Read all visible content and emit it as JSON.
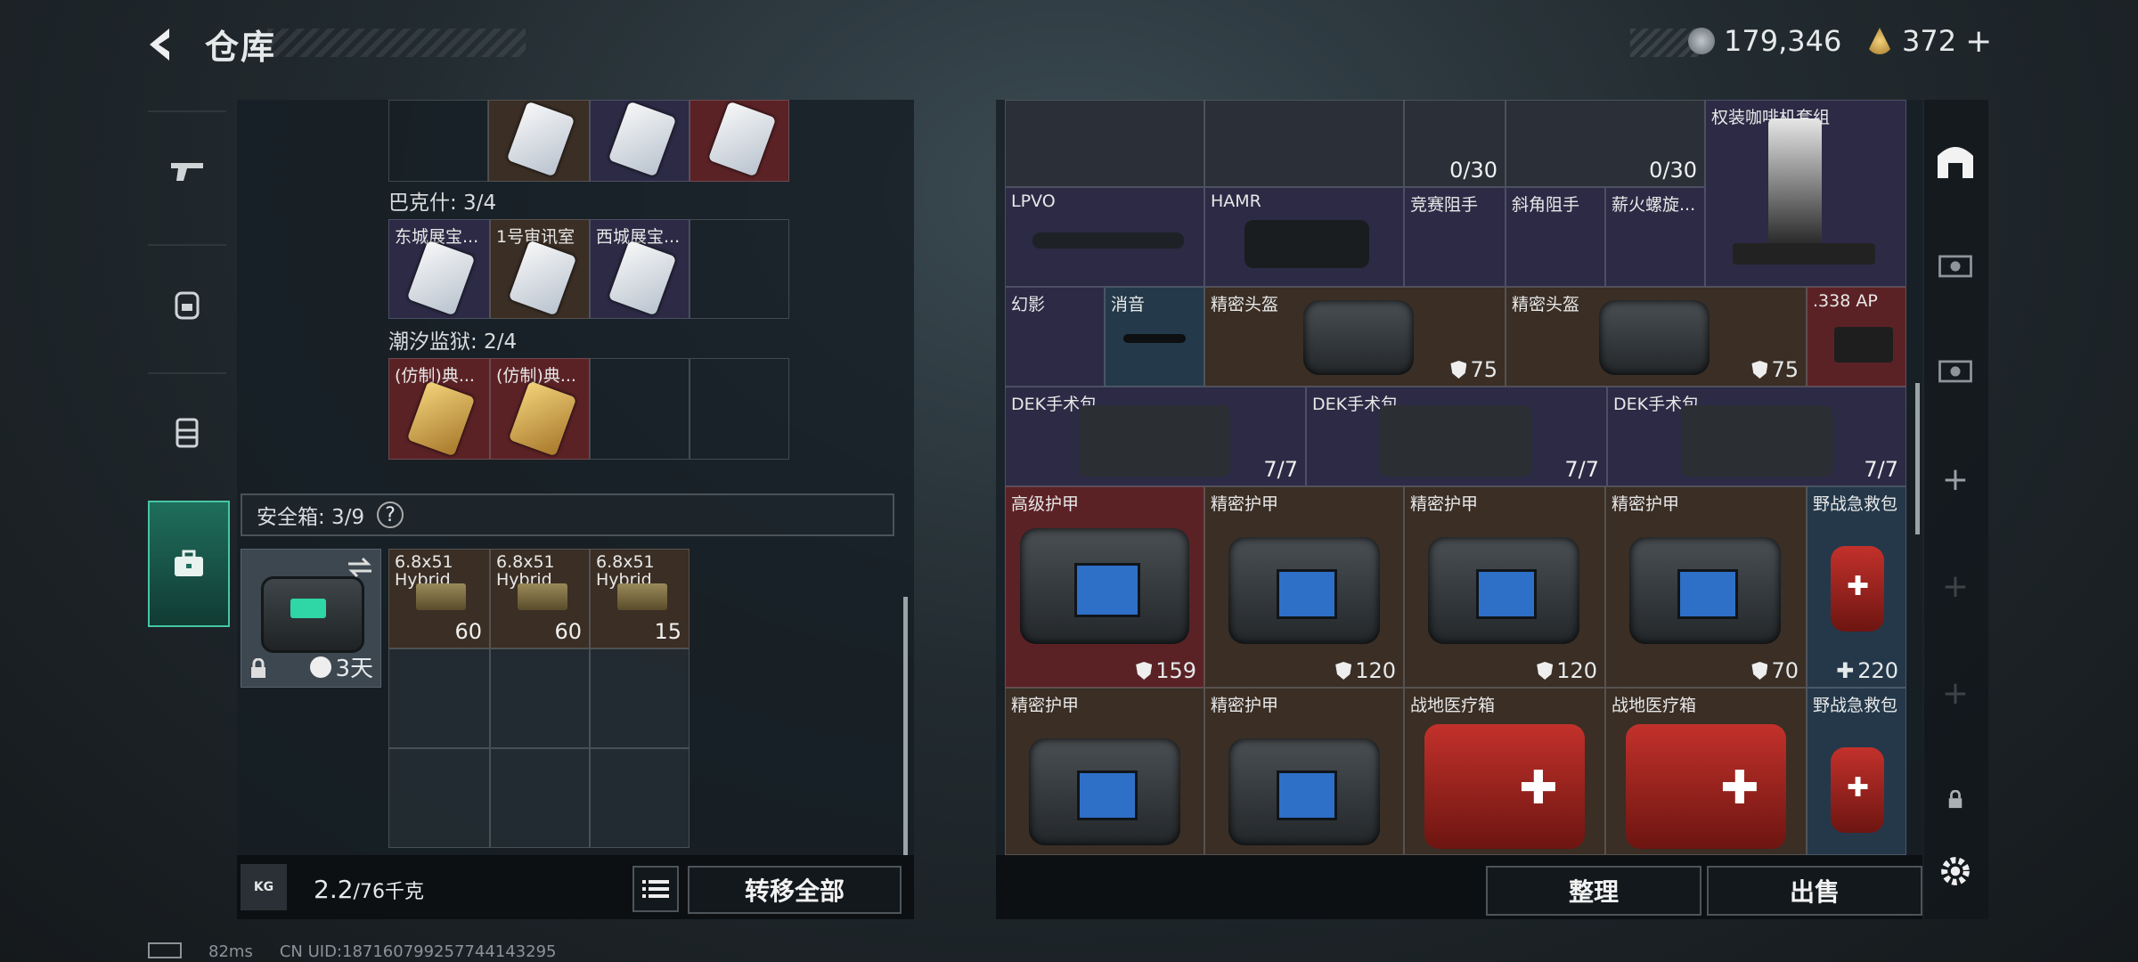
{
  "header": {
    "title": "仓库",
    "currency1": "179,346",
    "currency2": "372",
    "plus": "+"
  },
  "nav": [
    "weapon-icon",
    "backpack-icon",
    "chest-rig-icon",
    "toolbox-icon"
  ],
  "left": {
    "section1": {
      "label": "巴克什: 3/4",
      "items": [
        "东城展宝...",
        "1号审讯室",
        "西城展宝..."
      ]
    },
    "section2": {
      "label": "潮汐监狱: 2/4",
      "items": [
        "(仿制)典...",
        "(仿制)典..."
      ]
    },
    "safe": {
      "label": "安全箱:  3/9",
      "help": "?",
      "timer": "3天",
      "ammo": [
        {
          "name": "6.8x51 Hybrid",
          "count": "60"
        },
        {
          "name": "6.8x51 Hybrid",
          "count": "60"
        },
        {
          "name": "6.8x51 Hybrid",
          "count": "15"
        }
      ]
    },
    "weight": {
      "value": "2.2",
      "max": "/76千克",
      "kg_icon": "KG"
    },
    "transfer_btn": "转移全部"
  },
  "right": {
    "row0": {
      "count1": "0/30",
      "count2": "0/30",
      "banner": "权装咖啡机套组"
    },
    "row1": [
      "LPVO",
      "HAMR",
      "竞赛阻手",
      "斜角阻手",
      "薪火螺旋..."
    ],
    "row2": {
      "items": [
        "幻影",
        "消音",
        "精密头盔",
        "精密头盔",
        ".338 AP"
      ],
      "dur1": "75",
      "dur2": "75"
    },
    "row3": {
      "items": [
        "DEK手术包",
        "DEK手术包",
        "DEK手术包"
      ],
      "counts": [
        "7/7",
        "7/7",
        "7/7"
      ]
    },
    "row4": {
      "items": [
        "高级护甲",
        "精密护甲",
        "精密护甲",
        "精密护甲",
        "野战急救包"
      ],
      "vals": [
        "159",
        "120",
        "120",
        "70",
        "220"
      ]
    },
    "row5": {
      "items": [
        "精密护甲",
        "精密护甲",
        "战地医疗箱",
        "战地医疗箱",
        "野战急救包"
      ]
    },
    "sort_btn": "整理",
    "sell_btn": "出售"
  },
  "status": {
    "ping": "82ms",
    "uid": "CN UID:1871607992577441432​95"
  },
  "colors": {
    "accent": "#45c7a5",
    "red_slot": "#5b2226",
    "purple_slot": "#2c2a45",
    "brown_slot": "#3a2e25"
  }
}
